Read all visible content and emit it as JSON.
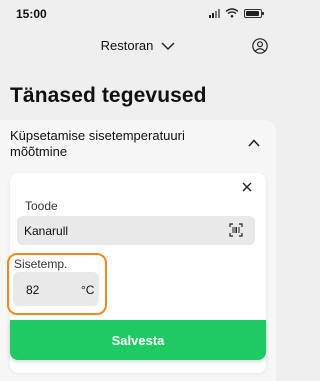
{
  "status_bar": {
    "time": "15:00",
    "icons": [
      "cellular-signal-icon",
      "wifi-icon",
      "battery-icon"
    ]
  },
  "header": {
    "location_selector": "Restoran",
    "icons": [
      "chevron-down-icon",
      "profile-icon"
    ]
  },
  "page": {
    "title": "Tänased tegevused"
  },
  "activity": {
    "title": "Küpsetamise sisetemperatuuri mõõtmine",
    "expanded": true
  },
  "form": {
    "product_label": "Toode",
    "product_value": "Kanarull",
    "temperature_label": "Sisetemp.",
    "temperature_value": "82",
    "temperature_unit": "°C",
    "save_label": "Salvesta"
  },
  "colors": {
    "accent_green": "#1ecb63",
    "highlight_orange": "#f08a1c",
    "field_bg": "#e9e9e9",
    "page_bg": "#efefef"
  }
}
